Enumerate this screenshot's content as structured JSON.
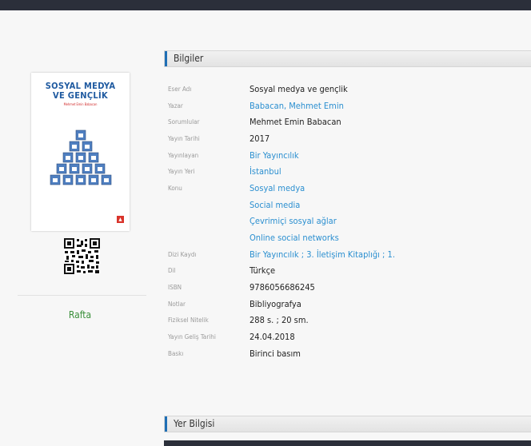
{
  "cover": {
    "title_line1": "SOSYAL MEDYA",
    "title_line2": "VE GENÇLİK",
    "author": "Mehmet Emin Babacan"
  },
  "left": {
    "shelf_label": "Rafta"
  },
  "info": {
    "header": "Bilgiler",
    "rows": [
      {
        "label": "Eser Adı",
        "value": "Sosyal medya ve gençlik",
        "link": false
      },
      {
        "label": "Yazar",
        "value": "Babacan, Mehmet Emin",
        "link": true
      },
      {
        "label": "Sorumlular",
        "value": "Mehmet Emin Babacan",
        "link": false
      },
      {
        "label": "Yayın Tarihi",
        "value": "2017",
        "link": false
      },
      {
        "label": "Yayınlayan",
        "value": "Bir Yayıncılık",
        "link": true
      },
      {
        "label": "Yayın Yeri",
        "value": "İstanbul",
        "link": true
      },
      {
        "label": "Konu",
        "value": "Sosyal medya",
        "link": true
      },
      {
        "label": "",
        "value": "Social media",
        "link": true
      },
      {
        "label": "",
        "value": "Çevrimiçi sosyal ağlar",
        "link": true
      },
      {
        "label": "",
        "value": "Online social networks",
        "link": true
      },
      {
        "label": "Dizi Kaydı",
        "value": "Bir Yayıncılık ; 3. İletişim Kitaplığı ; 1.",
        "link": true
      },
      {
        "label": "Dil",
        "value": "Türkçe",
        "link": false
      },
      {
        "label": "ISBN",
        "value": "9786056686245",
        "link": false
      },
      {
        "label": "Notlar",
        "value": "Bibliyografya",
        "link": false
      },
      {
        "label": "Fiziksel Nitelik",
        "value": "288 s. ; 20 sm.",
        "link": false
      },
      {
        "label": "Yayın Geliş Tarihi",
        "value": "24.04.2018",
        "link": false
      },
      {
        "label": "Baskı",
        "value": "Birinci basım",
        "link": false
      }
    ]
  },
  "location": {
    "header": "Yer Bilgisi"
  }
}
